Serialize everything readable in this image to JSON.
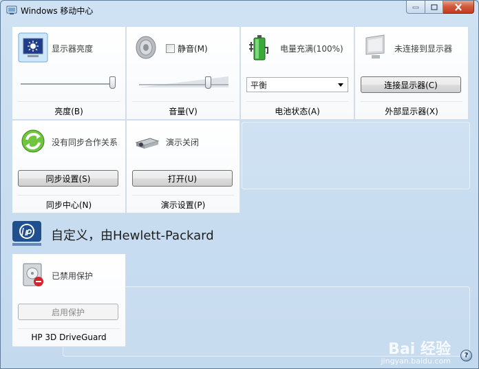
{
  "window": {
    "title": "Windows 移动中心"
  },
  "tiles": {
    "brightness": {
      "label": "显示器亮度",
      "title": "亮度(B)",
      "value_fraction": 1.0
    },
    "volume": {
      "mute_label": "静音(M)",
      "muted": false,
      "title": "音量(V)",
      "value_fraction": 0.76
    },
    "battery": {
      "label": "电量充满(100%)",
      "plan_value": "平衡",
      "title": "电池状态(A)"
    },
    "external_display": {
      "label": "未连接到显示器",
      "button": "连接显示器(C)",
      "title": "外部显示器(X)"
    },
    "sync": {
      "label": "没有同步合作关系",
      "button": "同步设置(S)",
      "title": "同步中心(N)"
    },
    "presentation": {
      "label": "演示关闭",
      "button": "打开(U)",
      "title": "演示设置(P)"
    },
    "driveguard": {
      "label": "已禁用保护",
      "button": "启用保护",
      "title": "HP 3D DriveGuard"
    }
  },
  "oem": {
    "heading": "自定义，由Hewlett-Packard"
  },
  "icons": [
    "app-icon",
    "brightness-icon",
    "speaker-icon",
    "battery-icon",
    "monitor-icon",
    "sync-icon",
    "projector-icon",
    "hp-logo-icon",
    "drive-protection-icon",
    "help-icon"
  ],
  "watermark": {
    "text": "Bai 经验",
    "url": "jingyan.baidu.com"
  },
  "colors": {
    "window_bg": "#c9def1",
    "tile_bg": "#ffffff",
    "close_button": "#c4391e"
  }
}
